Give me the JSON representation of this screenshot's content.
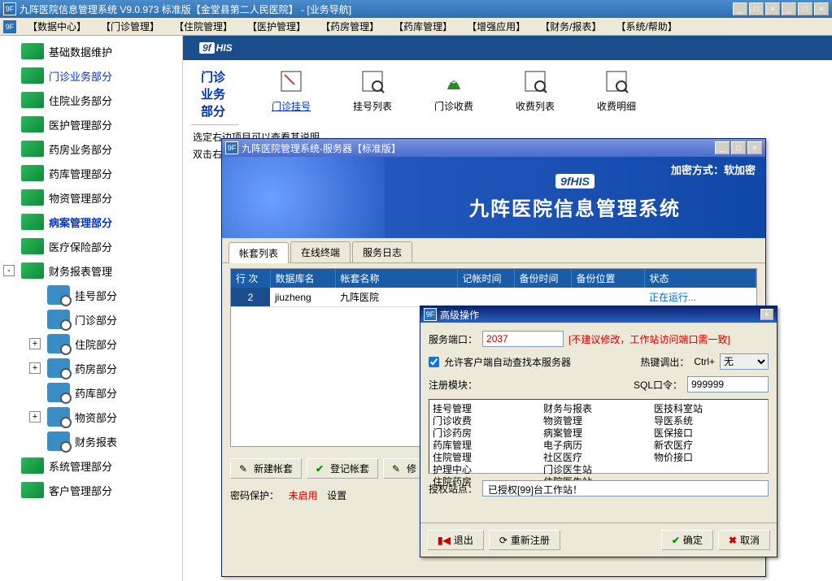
{
  "window": {
    "icon_text": "9F",
    "title": "九阵医院信息管理系统   V9.0.973 标准版【金堂县第二人民医院】  - [业务导航]",
    "min": "_",
    "max": "□",
    "close": "×"
  },
  "menu": {
    "icon_text": "9F",
    "items": [
      "【数据中心】",
      "【门诊管理】",
      "【住院管理】",
      "【医护管理】",
      "【药房管理】",
      "【药库管理】",
      "【增强应用】",
      "【财务/报表】",
      "【系统/帮助】"
    ]
  },
  "sidebar": {
    "items": [
      {
        "label": "基础数据维护",
        "type": "green"
      },
      {
        "label": "门诊业务部分",
        "type": "green",
        "selected": true
      },
      {
        "label": "住院业务部分",
        "type": "green"
      },
      {
        "label": "医护管理部分",
        "type": "green"
      },
      {
        "label": "药房业务部分",
        "type": "green"
      },
      {
        "label": "药库管理部分",
        "type": "green"
      },
      {
        "label": "物资管理部分",
        "type": "green"
      },
      {
        "label": "病案管理部分",
        "type": "green",
        "bold": true
      },
      {
        "label": "医疗保险部分",
        "type": "green"
      },
      {
        "label": "财务报表管理",
        "type": "green",
        "exp": "-"
      },
      {
        "label": "挂号部分",
        "type": "mag",
        "sub": true
      },
      {
        "label": "门诊部分",
        "type": "mag",
        "sub": true
      },
      {
        "label": "住院部分",
        "type": "mag",
        "sub": true,
        "exp": "+"
      },
      {
        "label": "药房部分",
        "type": "mag",
        "sub": true,
        "exp": "+"
      },
      {
        "label": "药库部分",
        "type": "mag",
        "sub": true
      },
      {
        "label": "物资部分",
        "type": "mag",
        "sub": true,
        "exp": "+"
      },
      {
        "label": "财务报表",
        "type": "mag",
        "sub": true
      },
      {
        "label": "系统管理部分",
        "type": "green"
      },
      {
        "label": "客户管理部分",
        "type": "green"
      }
    ]
  },
  "brand": {
    "prefix": "9f",
    "suffix": "HIS"
  },
  "section_title": "门诊业务部分",
  "toolbar": [
    {
      "label": "门诊挂号",
      "active": true
    },
    {
      "label": "挂号列表"
    },
    {
      "label": "门诊收费"
    },
    {
      "label": "收费列表"
    },
    {
      "label": "收费明细"
    }
  ],
  "hints": {
    "line1": "选定右边项目可以查看其说明",
    "line2": "双击右边"
  },
  "server_modal": {
    "icon_text": "9F",
    "title": "九阵医院管理系统-服务器【标准版】",
    "min": "_",
    "max": "□",
    "close": "×",
    "banner": {
      "brand": "9fHIS",
      "title": "九阵医院信息管理系统",
      "encrypt": "加密方式：软加密"
    },
    "tabs": [
      "帐套列表",
      "在线终端",
      "服务日志"
    ],
    "table": {
      "headers": [
        "行 次",
        "数据库名",
        "帐套名称",
        "记帐时间",
        "备份时间",
        "备份位置",
        "状态"
      ],
      "row": {
        "rn": "2",
        "db": "jiuzheng",
        "name": "九阵医院",
        "t1": "",
        "t2": "",
        "loc": "",
        "status": "正在运行..."
      }
    },
    "buttons": {
      "new": "新建帐套",
      "login": "登记帐套",
      "edit": "修"
    },
    "pwd": {
      "label": "密码保护：",
      "status": "未启用",
      "set": "设置"
    }
  },
  "adv_dialog": {
    "icon_text": "9F",
    "title": "高级操作",
    "close": "×",
    "port_label": "服务端口：",
    "port_value": "2037",
    "port_warn": "[不建议修改，工作站访问端口需一致]",
    "auto_check": "允许客户端自动查找本服务器",
    "hotkey_label": "热键调出：",
    "hotkey_prefix": "Ctrl+",
    "hotkey_value": "无",
    "reg_label": "注册模块：",
    "sql_label": "SQL口令：",
    "sql_value": "999999",
    "modules": {
      "col1": [
        "挂号管理",
        "门诊收费",
        "门诊药房",
        "药库管理",
        "住院管理",
        "护理中心",
        "住院药房"
      ],
      "col2": [
        "财务与报表",
        "物资管理",
        "病案管理",
        "电子病历",
        "社区医疗",
        "门诊医生站",
        "住院医生站"
      ],
      "col3": [
        "医技科室站",
        "导医系统",
        "医保接口",
        "新农医疗",
        "物价接口"
      ]
    },
    "auth_label": "授权站点：",
    "auth_value": "已授权[99]台工作站！",
    "buttons": {
      "exit": "退出",
      "rereg": "重新注册",
      "ok": "确定",
      "cancel": "取消"
    }
  }
}
